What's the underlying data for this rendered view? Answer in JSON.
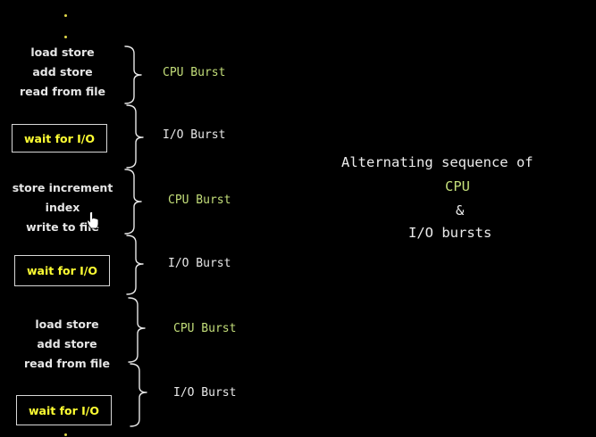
{
  "blocks": [
    {
      "kind": "cpu",
      "lines": [
        "load store",
        "add store",
        "read from file"
      ],
      "label": "CPU Burst"
    },
    {
      "kind": "io",
      "wait": "wait for I/O",
      "label": "I/O Burst"
    },
    {
      "kind": "cpu",
      "lines": [
        "store increment",
        "index",
        "write to file"
      ],
      "label": "CPU Burst"
    },
    {
      "kind": "io",
      "wait": "wait for I/O",
      "label": "I/O Burst"
    },
    {
      "kind": "cpu",
      "lines": [
        "load store",
        "add store",
        "read from file"
      ],
      "label": "CPU Burst"
    },
    {
      "kind": "io",
      "wait": "wait for I/O",
      "label": "I/O Burst"
    }
  ],
  "heading": {
    "line1": "Alternating sequence of",
    "line2": "CPU",
    "line3": "&",
    "line4": "I/O bursts"
  },
  "colors": {
    "background": "#000000",
    "cpu_label": "#c4df7a",
    "io_label": "#e8e8e8",
    "wait_text": "#ffff33",
    "instruction_text": "#e6e6e6",
    "heading_text": "#ececec",
    "heading_accent": "#c4df7a"
  },
  "icons": {
    "cursor": "hand-pointer-icon"
  }
}
